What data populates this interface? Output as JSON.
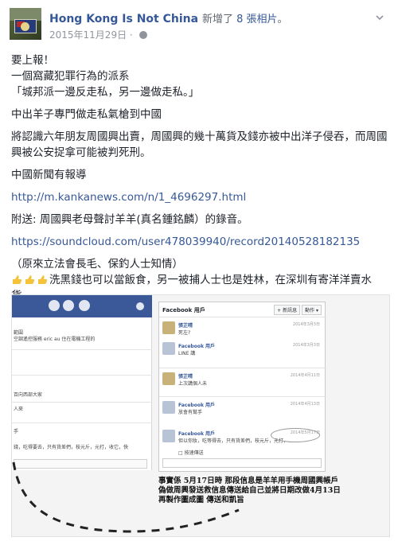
{
  "post": {
    "page_name": "Hong Kong Is Not China",
    "action_prefix": "新增了",
    "photo_count": "8 張相片",
    "action_suffix": "。",
    "date": "2015年11月29日",
    "date_sep": "·"
  },
  "body": {
    "l1": "要上報！",
    "l2": "一個窩藏犯罪行為的派系",
    "l3": "「城邦派一邊反走私，另一邊做走私。」",
    "l4": "中出羊子專門做走私氣槍到中國",
    "l5": "將認識六年朋友周國興出賣，周國興的幾十萬貨及錢亦被中出洋子侵吞，而周國興被公安捉拿可能被判死刑。",
    "l6": "中國新聞有報導",
    "l7": "http://m.kankanews.com/n/1_4696297.html",
    "l8": "附送: 周國興老母聲討羊羊(真名鍾銘麟）的錄音。",
    "l9": "https://soundcloud.com/user478039940/record20140528182135",
    "l10": "（原來立法會長毛、保釣人士知情）",
    "l11": "洗黑錢也可以當飯食，另一被捕人士也是姓林，在深圳有寄洋洋賣水貨。"
  },
  "photo": {
    "fb_title": "Facebook 用戶",
    "btn_new": "+ 新訊息",
    "btn_actions": "動作 ▾",
    "messages": [
      {
        "name": "張芷晴",
        "text": "死左?",
        "time": "2014年3月3日"
      },
      {
        "name": "Facebook 用戶",
        "text": "LINE 講",
        "time": "2014年3月3日"
      },
      {
        "name": "張芷晴",
        "text": "上次講個人未",
        "time": "2014年4月11日"
      },
      {
        "name": "Facebook 用戶",
        "text": "放會有幫手",
        "time": "2014年4月13日"
      },
      {
        "name": "Facebook 用戶",
        "text": "但以你妝，吃等得去，只有貨差們，枝元斤，元打，…",
        "time": "2014年5月17日"
      }
    ],
    "reply_note": "□ 按速傳送",
    "left_rows": [
      "範圍",
      "空調遙控服務 eric au 住在電機工程的",
      "百向西部大家",
      "人來",
      "手",
      "錢，吃得要去，只有貨差們，枝元斤，元打，收它，快"
    ],
    "note": "事實係 5月17日時 那段信息是羊羊用手機周國興帳戶偽做周興發送救信息傳送給自己並將日期改做4月13日 再製作圖成圖 傳送和凱旨"
  }
}
